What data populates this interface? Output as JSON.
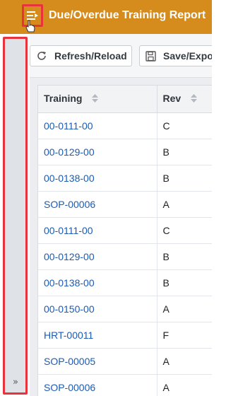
{
  "header": {
    "title": "Due/Overdue Training Report",
    "menu_icon": "menu-icon",
    "background": "#d68c1c"
  },
  "sidebar": {
    "expand_label": "»"
  },
  "toolbar": {
    "refresh_label": "Refresh/Reload",
    "save_label": "Save/Expo"
  },
  "table": {
    "columns": [
      "Training",
      "Rev"
    ],
    "rows": [
      {
        "training": "00-0111-00",
        "rev": "C"
      },
      {
        "training": "00-0129-00",
        "rev": "B"
      },
      {
        "training": "00-0138-00",
        "rev": "B"
      },
      {
        "training": "SOP-00006",
        "rev": "A"
      },
      {
        "training": "00-0111-00",
        "rev": "C"
      },
      {
        "training": "00-0129-00",
        "rev": "B"
      },
      {
        "training": "00-0138-00",
        "rev": "B"
      },
      {
        "training": "00-0150-00",
        "rev": "A"
      },
      {
        "training": "HRT-00011",
        "rev": "F"
      },
      {
        "training": "SOP-00005",
        "rev": "A"
      },
      {
        "training": "SOP-00006",
        "rev": "A"
      }
    ]
  },
  "colors": {
    "highlight": "#e8323c",
    "link": "#1a5bb5"
  }
}
